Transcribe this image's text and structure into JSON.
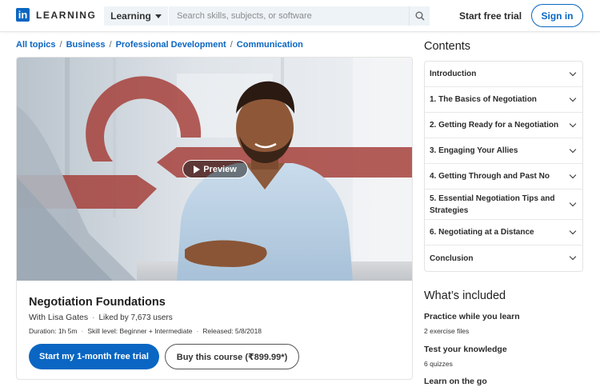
{
  "header": {
    "logo_text": "LEARNING",
    "logo_badge": "in",
    "learning_dropdown": "Learning",
    "search_placeholder": "Search skills, subjects, or software",
    "start_trial": "Start free trial",
    "sign_in": "Sign in",
    "brand_color": "#0a66c2"
  },
  "breadcrumb": [
    "All topics",
    "Business",
    "Professional Development",
    "Communication"
  ],
  "course": {
    "preview_label": "Preview",
    "title": "Negotiation Foundations",
    "author": "With Lisa Gates",
    "likes": "Liked by 7,673 users",
    "duration": "Duration: 1h 5m",
    "skill_level": "Skill level: Beginner + Intermediate",
    "released": "Released: 5/8/2018",
    "primary_cta": "Start my 1-month free trial",
    "secondary_cta": "Buy this course (₹899.99*)"
  },
  "contents": {
    "title": "Contents",
    "items": [
      "Introduction",
      "1. The Basics of Negotiation",
      "2. Getting Ready for a Negotiation",
      "3. Engaging Your Allies",
      "4. Getting Through and Past No",
      "5. Essential Negotiation Tips and Strategies",
      "6. Negotiating at a Distance",
      "Conclusion"
    ]
  },
  "included": {
    "title": "What’s included",
    "items": [
      {
        "heading": "Practice while you learn",
        "detail": "2 exercise files"
      },
      {
        "heading": "Test your knowledge",
        "detail": "6 quizzes"
      },
      {
        "heading": "Learn on the go",
        "detail": ""
      }
    ]
  }
}
